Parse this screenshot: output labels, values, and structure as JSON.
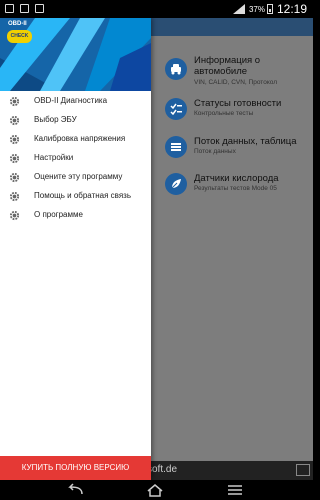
{
  "status_bar": {
    "battery": "37%",
    "time": "12:19"
  },
  "logo": {
    "line1": "OBD-II",
    "line2": "CHECK"
  },
  "drawer": {
    "items": [
      {
        "label": "OBD-II Диагностика"
      },
      {
        "label": "Выбор ЭБУ"
      },
      {
        "label": "Калибровка напряжения"
      },
      {
        "label": "Настройки"
      },
      {
        "label": "Оцените эту программу"
      },
      {
        "label": "Помощь и обратная связь"
      },
      {
        "label": "О программе"
      }
    ],
    "buy_button": "КУПИТЬ ПОЛНУЮ ВЕРСИЮ"
  },
  "main": {
    "items": [
      {
        "title": "Информация о автомобиле",
        "sub": "VIN, CALID, CVN, Протокол",
        "icon": "car-icon"
      },
      {
        "title": "Статусы готовности",
        "sub": "Контрольные тесты",
        "icon": "list-check-icon"
      },
      {
        "title": "Поток данных, таблица",
        "sub": "Поток данных",
        "icon": "list-icon"
      },
      {
        "title": "Датчики кислорода",
        "sub": "Результаты тестов Mode 05",
        "icon": "leaf-icon"
      }
    ],
    "ad_text": "soft.de"
  },
  "colors": {
    "accent": "#1f5fa0",
    "buy": "#e53935",
    "overlay": "#7d7d7d"
  }
}
